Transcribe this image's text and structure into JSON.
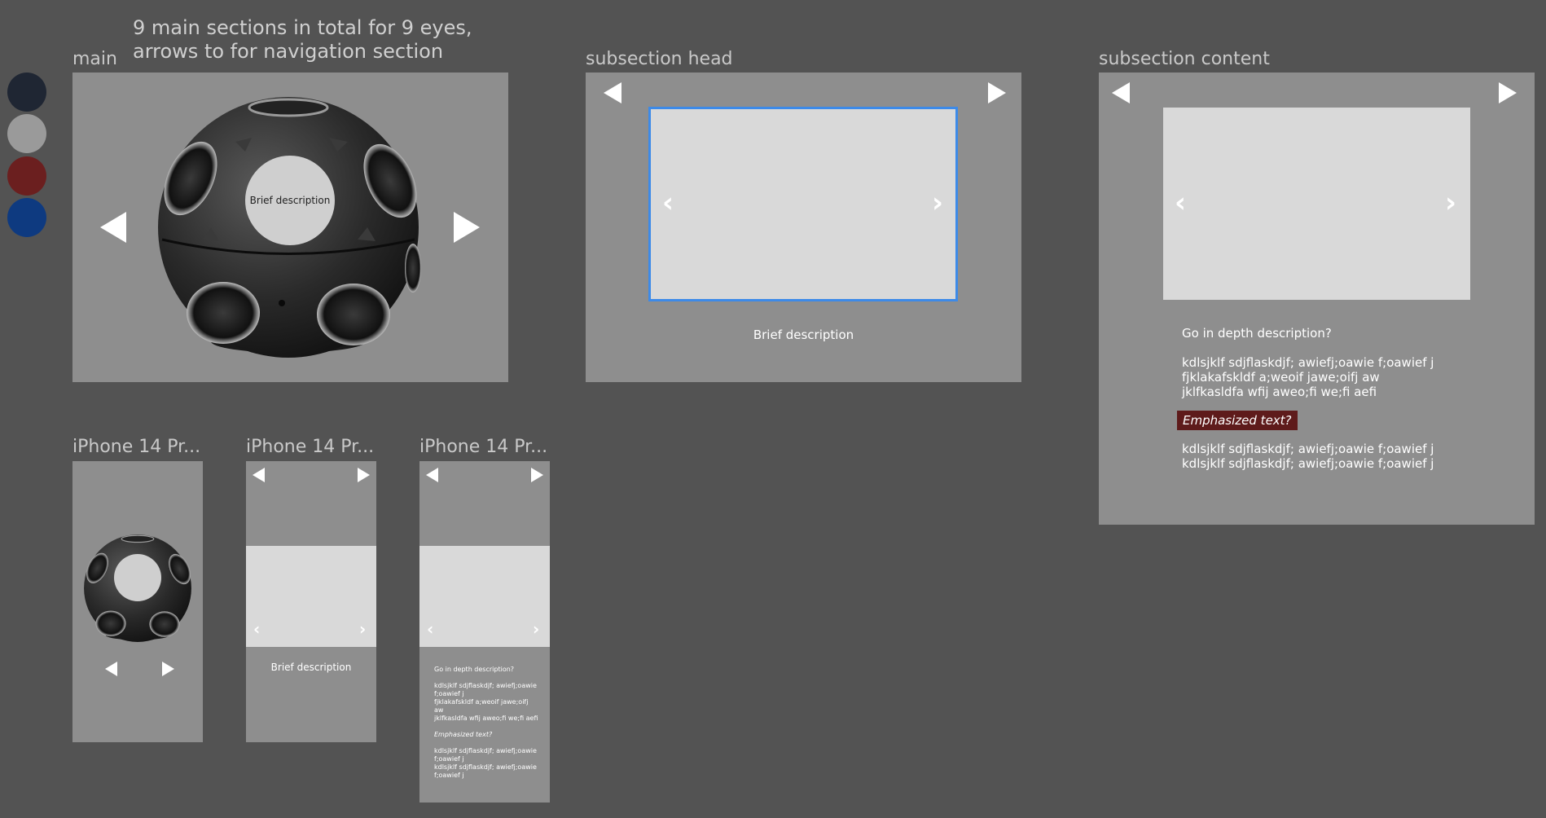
{
  "note": {
    "line1": "9 main sections in total for 9 eyes,",
    "line2": "arrows to for navigation section"
  },
  "frames": {
    "main": {
      "label": "main",
      "brief": "Brief description"
    },
    "subsection_head": {
      "label": "subsection head",
      "brief": "Brief description"
    },
    "subsection_content": {
      "label": "subsection content",
      "question": "Go in depth description?",
      "para1": [
        "kdlsjklf sdjflaskdjf; awiefj;oawie f;oawief j",
        "fjklakafskldf a;weoif jawe;oifj aw",
        "jklfkasldfa wfij aweo;fi we;fi aefi"
      ],
      "emphasized": "Emphasized text?",
      "para2": [
        "kdlsjklf sdjflaskdjf; awiefj;oawie f;oawief j",
        "kdlsjklf sdjflaskdjf; awiefj;oawie f;oawief j"
      ]
    },
    "iphone1": {
      "label": "iPhone 14 Pr..."
    },
    "iphone2": {
      "label": "iPhone 14 Pr...",
      "brief": "Brief description"
    },
    "iphone3": {
      "label": "iPhone 14 Pr...",
      "question": "Go in depth description?",
      "para1": [
        "kdlsjklf sdjflaskdjf; awiefj;oawie",
        "f;oawief j",
        "fjklakafskldf a;weoif jawe;oifj",
        "aw",
        "jklfkasldfa wfij aweo;fi we;fi aefi"
      ],
      "emphasized": "Emphasized text?",
      "para2": [
        "kdlsjklf sdjflaskdjf; awiefj;oawie",
        "f;oawief j",
        "kdlsjklf sdjflaskdjf; awiefj;oawie",
        "f;oawief j"
      ]
    }
  },
  "swatches": [
    "#1f2633",
    "#9a9a9a",
    "#6b1f1f",
    "#0e3a80"
  ],
  "icons": {
    "prev": "triangle-left-icon",
    "next": "triangle-right-icon",
    "chevron_left": "‹",
    "chevron_right": "›"
  },
  "colors": {
    "background": "#535353",
    "frame": "#8e8e8e",
    "card": "#d9d9d9",
    "selection": "#3d8ae8",
    "emphasis": "#5e1b1b"
  }
}
